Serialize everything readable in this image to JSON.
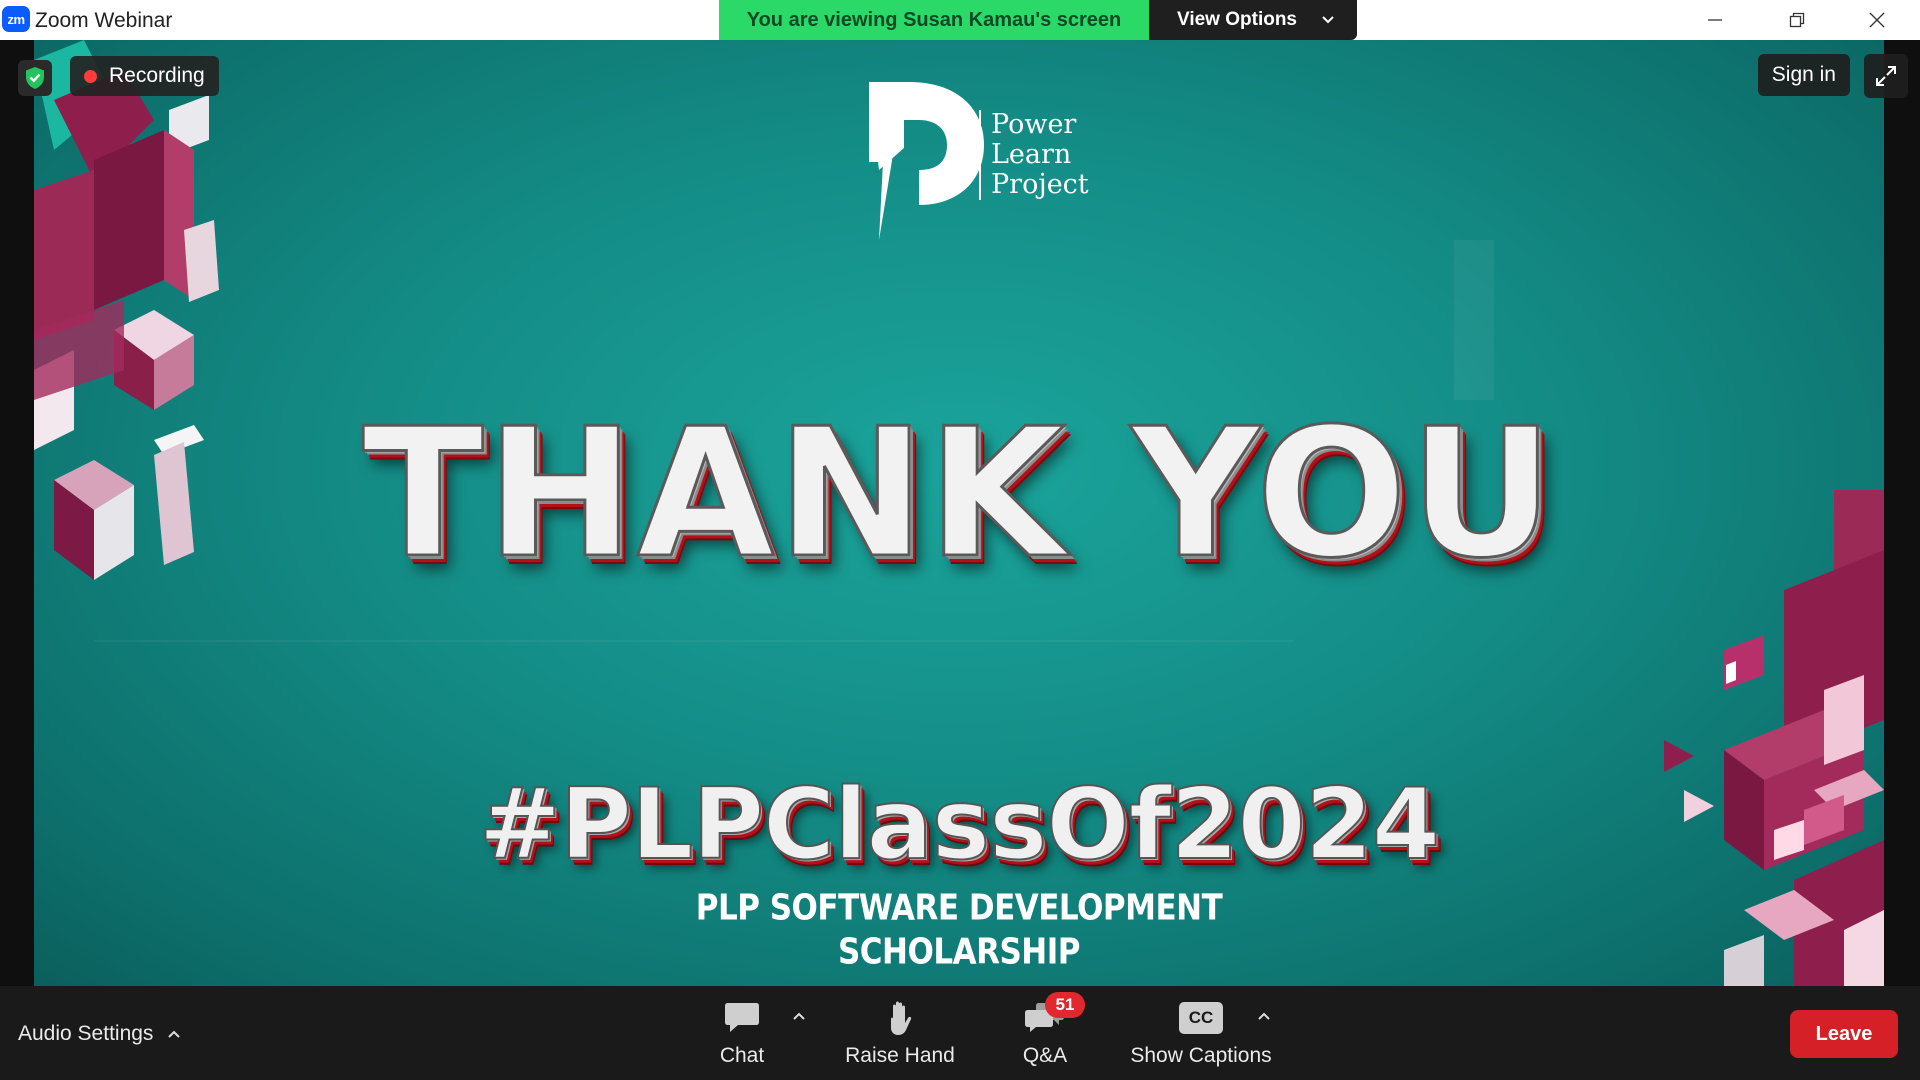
{
  "window": {
    "app_logo_text": "zm",
    "title": "Zoom Webinar",
    "share_banner": "You are viewing Susan Kamau's screen",
    "view_options_label": "View Options"
  },
  "meeting": {
    "recording_label": "Recording",
    "sign_in_label": "Sign in"
  },
  "slide": {
    "logo_lines": [
      "Power",
      "Learn",
      "Project"
    ],
    "headline": "THANK YOU",
    "hashtag": "#PLPClassOf2024",
    "subtitle_lines": [
      "PLP SOFTWARE DEVELOPMENT",
      "SCHOLARSHIP"
    ],
    "colors": {
      "background": "#148c86",
      "accent": "#b3101a",
      "shape": "#8e1f4d"
    }
  },
  "toolbar": {
    "audio_settings_label": "Audio Settings",
    "chat_label": "Chat",
    "raise_hand_label": "Raise Hand",
    "qa_label": "Q&A",
    "qa_badge": "51",
    "captions_icon_text": "CC",
    "captions_label": "Show Captions",
    "leave_label": "Leave"
  },
  "colors": {
    "share_banner": "#2bd968",
    "leave_button": "#d62027",
    "recording_dot": "#ff3b3b"
  }
}
